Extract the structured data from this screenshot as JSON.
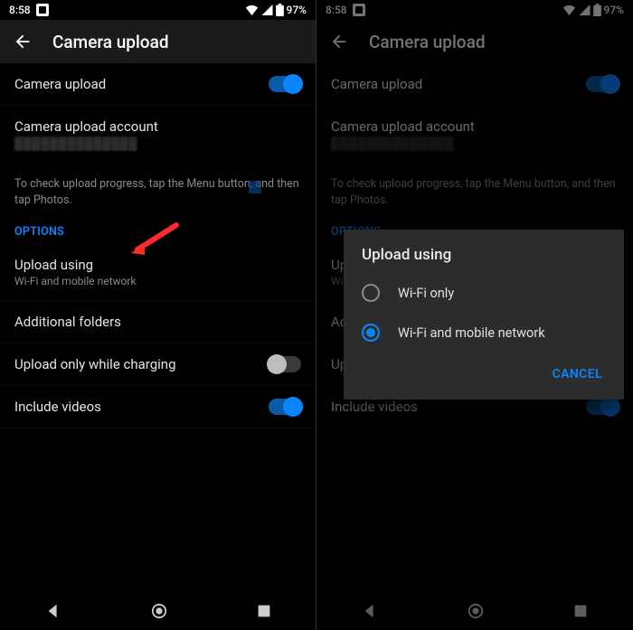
{
  "status": {
    "time": "8:58",
    "battery": "97%"
  },
  "header": {
    "title": "Camera upload"
  },
  "settings": {
    "camera_upload": {
      "label": "Camera upload"
    },
    "account": {
      "label": "Camera upload account"
    },
    "help": "To check upload progress, tap the Menu button, and then tap Photos.",
    "options_header": "OPTIONS",
    "upload_using": {
      "label": "Upload using",
      "value": "Wi-Fi and mobile network"
    },
    "additional_folders": {
      "label": "Additional folders"
    },
    "charging": {
      "label": "Upload only while charging"
    },
    "videos": {
      "label": "Include videos"
    }
  },
  "dialog": {
    "title": "Upload using",
    "options": [
      {
        "label": "Wi-Fi only"
      },
      {
        "label": "Wi-Fi and mobile network"
      }
    ],
    "cancel": "CANCEL"
  }
}
